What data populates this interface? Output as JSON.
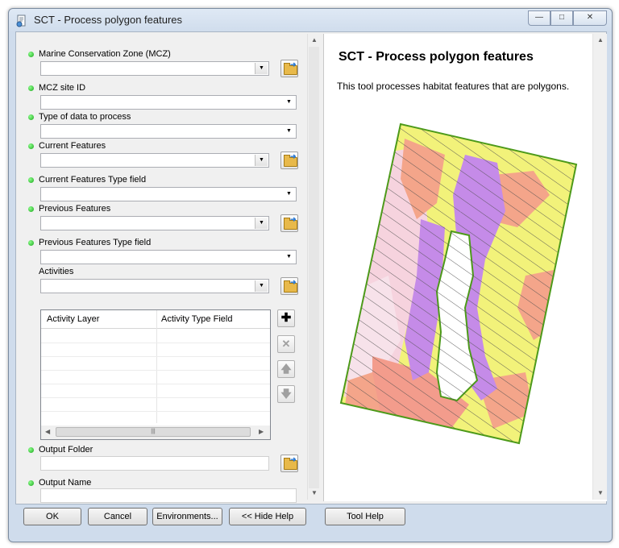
{
  "window": {
    "title": "SCT - Process polygon features",
    "controls": [
      "minimize-icon",
      "maximize-icon",
      "close-icon"
    ]
  },
  "form": {
    "fields": [
      {
        "label": "Marine Conservation Zone (MCZ)",
        "required": true,
        "value": "",
        "has_browse": true
      },
      {
        "label": "MCZ site ID",
        "required": true,
        "value": "",
        "has_browse": false
      },
      {
        "label": "Type of data to process",
        "required": true,
        "value": "",
        "has_browse": false
      },
      {
        "label": "Current Features",
        "required": true,
        "value": "",
        "has_browse": true
      },
      {
        "label": "Current Features Type field",
        "required": true,
        "value": "",
        "has_browse": false
      },
      {
        "label": "Previous Features",
        "required": true,
        "value": "",
        "has_browse": true
      },
      {
        "label": "Previous Features Type field",
        "required": true,
        "value": "",
        "has_browse": false
      },
      {
        "label": "Activities",
        "required": false,
        "value": "",
        "has_browse": true
      }
    ],
    "activities_table": {
      "columns": [
        "Activity Layer",
        "Activity Type Field"
      ],
      "rows": [],
      "buttons": [
        "add-icon",
        "remove-icon",
        "move-up-icon",
        "move-down-icon"
      ]
    },
    "output_folder": {
      "label": "Output Folder",
      "value": ""
    },
    "output_name": {
      "label": "Output Name",
      "value": ""
    }
  },
  "help": {
    "title": "SCT - Process polygon features",
    "text": "This tool processes habitat features that are polygons.",
    "image": "habitat-polygon-map",
    "colors": {
      "hatch_fill": "#f2f27a",
      "outline": "#4d9a1a",
      "purple": "#c58be8",
      "salmon": "#f4a58a",
      "pink": "#f6d3de"
    }
  },
  "buttons": {
    "ok": "OK",
    "cancel": "Cancel",
    "environments": "Environments...",
    "hide_help": "<< Hide Help",
    "tool_help": "Tool Help"
  }
}
